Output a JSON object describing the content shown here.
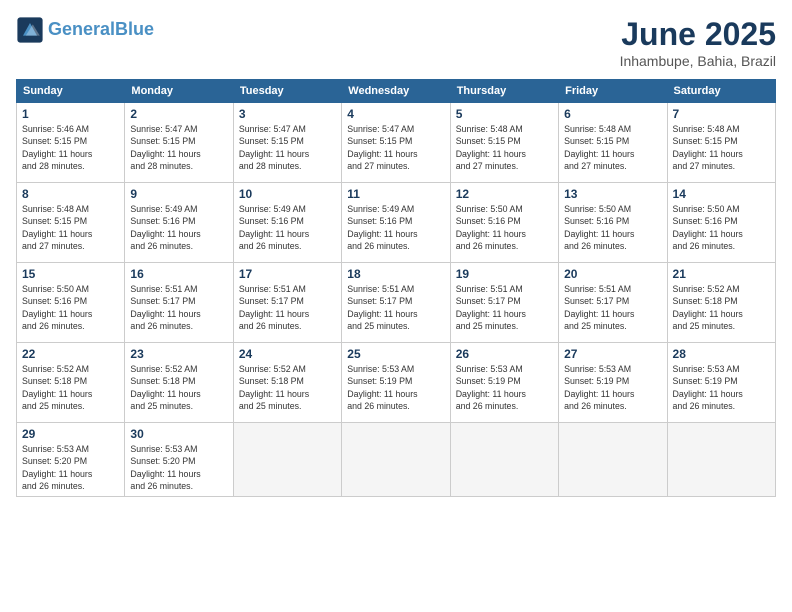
{
  "logo": {
    "line1": "General",
    "line2": "Blue"
  },
  "title": "June 2025",
  "location": "Inhambupe, Bahia, Brazil",
  "headers": [
    "Sunday",
    "Monday",
    "Tuesday",
    "Wednesday",
    "Thursday",
    "Friday",
    "Saturday"
  ],
  "weeks": [
    [
      {
        "day": "1",
        "info": "Sunrise: 5:46 AM\nSunset: 5:15 PM\nDaylight: 11 hours\nand 28 minutes."
      },
      {
        "day": "2",
        "info": "Sunrise: 5:47 AM\nSunset: 5:15 PM\nDaylight: 11 hours\nand 28 minutes."
      },
      {
        "day": "3",
        "info": "Sunrise: 5:47 AM\nSunset: 5:15 PM\nDaylight: 11 hours\nand 28 minutes."
      },
      {
        "day": "4",
        "info": "Sunrise: 5:47 AM\nSunset: 5:15 PM\nDaylight: 11 hours\nand 27 minutes."
      },
      {
        "day": "5",
        "info": "Sunrise: 5:48 AM\nSunset: 5:15 PM\nDaylight: 11 hours\nand 27 minutes."
      },
      {
        "day": "6",
        "info": "Sunrise: 5:48 AM\nSunset: 5:15 PM\nDaylight: 11 hours\nand 27 minutes."
      },
      {
        "day": "7",
        "info": "Sunrise: 5:48 AM\nSunset: 5:15 PM\nDaylight: 11 hours\nand 27 minutes."
      }
    ],
    [
      {
        "day": "8",
        "info": "Sunrise: 5:48 AM\nSunset: 5:15 PM\nDaylight: 11 hours\nand 27 minutes."
      },
      {
        "day": "9",
        "info": "Sunrise: 5:49 AM\nSunset: 5:16 PM\nDaylight: 11 hours\nand 26 minutes."
      },
      {
        "day": "10",
        "info": "Sunrise: 5:49 AM\nSunset: 5:16 PM\nDaylight: 11 hours\nand 26 minutes."
      },
      {
        "day": "11",
        "info": "Sunrise: 5:49 AM\nSunset: 5:16 PM\nDaylight: 11 hours\nand 26 minutes."
      },
      {
        "day": "12",
        "info": "Sunrise: 5:50 AM\nSunset: 5:16 PM\nDaylight: 11 hours\nand 26 minutes."
      },
      {
        "day": "13",
        "info": "Sunrise: 5:50 AM\nSunset: 5:16 PM\nDaylight: 11 hours\nand 26 minutes."
      },
      {
        "day": "14",
        "info": "Sunrise: 5:50 AM\nSunset: 5:16 PM\nDaylight: 11 hours\nand 26 minutes."
      }
    ],
    [
      {
        "day": "15",
        "info": "Sunrise: 5:50 AM\nSunset: 5:16 PM\nDaylight: 11 hours\nand 26 minutes."
      },
      {
        "day": "16",
        "info": "Sunrise: 5:51 AM\nSunset: 5:17 PM\nDaylight: 11 hours\nand 26 minutes."
      },
      {
        "day": "17",
        "info": "Sunrise: 5:51 AM\nSunset: 5:17 PM\nDaylight: 11 hours\nand 26 minutes."
      },
      {
        "day": "18",
        "info": "Sunrise: 5:51 AM\nSunset: 5:17 PM\nDaylight: 11 hours\nand 25 minutes."
      },
      {
        "day": "19",
        "info": "Sunrise: 5:51 AM\nSunset: 5:17 PM\nDaylight: 11 hours\nand 25 minutes."
      },
      {
        "day": "20",
        "info": "Sunrise: 5:51 AM\nSunset: 5:17 PM\nDaylight: 11 hours\nand 25 minutes."
      },
      {
        "day": "21",
        "info": "Sunrise: 5:52 AM\nSunset: 5:18 PM\nDaylight: 11 hours\nand 25 minutes."
      }
    ],
    [
      {
        "day": "22",
        "info": "Sunrise: 5:52 AM\nSunset: 5:18 PM\nDaylight: 11 hours\nand 25 minutes."
      },
      {
        "day": "23",
        "info": "Sunrise: 5:52 AM\nSunset: 5:18 PM\nDaylight: 11 hours\nand 25 minutes."
      },
      {
        "day": "24",
        "info": "Sunrise: 5:52 AM\nSunset: 5:18 PM\nDaylight: 11 hours\nand 25 minutes."
      },
      {
        "day": "25",
        "info": "Sunrise: 5:53 AM\nSunset: 5:19 PM\nDaylight: 11 hours\nand 26 minutes."
      },
      {
        "day": "26",
        "info": "Sunrise: 5:53 AM\nSunset: 5:19 PM\nDaylight: 11 hours\nand 26 minutes."
      },
      {
        "day": "27",
        "info": "Sunrise: 5:53 AM\nSunset: 5:19 PM\nDaylight: 11 hours\nand 26 minutes."
      },
      {
        "day": "28",
        "info": "Sunrise: 5:53 AM\nSunset: 5:19 PM\nDaylight: 11 hours\nand 26 minutes."
      }
    ],
    [
      {
        "day": "29",
        "info": "Sunrise: 5:53 AM\nSunset: 5:20 PM\nDaylight: 11 hours\nand 26 minutes."
      },
      {
        "day": "30",
        "info": "Sunrise: 5:53 AM\nSunset: 5:20 PM\nDaylight: 11 hours\nand 26 minutes."
      },
      {
        "day": "",
        "info": ""
      },
      {
        "day": "",
        "info": ""
      },
      {
        "day": "",
        "info": ""
      },
      {
        "day": "",
        "info": ""
      },
      {
        "day": "",
        "info": ""
      }
    ]
  ]
}
